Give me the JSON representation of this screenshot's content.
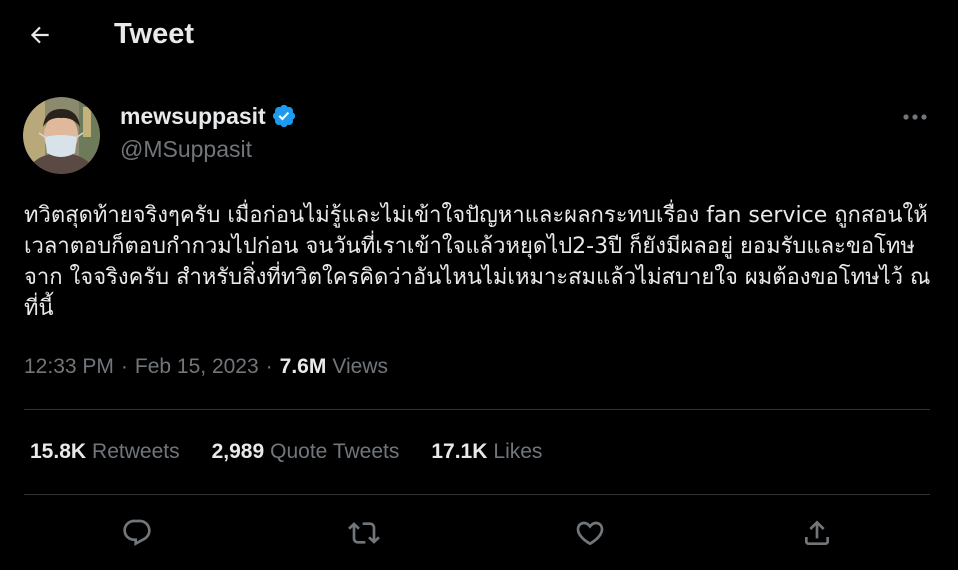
{
  "header": {
    "title": "Tweet",
    "back_icon": "arrow-left-icon"
  },
  "author": {
    "name": "mewsuppasit",
    "handle": "@MSuppasit",
    "verified": true,
    "verified_color": "#1d9bf0"
  },
  "tweet": {
    "text": "ทวิตสุดท้ายจริงๆครับ เมื่อก่อนไม่รู้และไม่เข้าใจปัญหาและผลกระทบเรื่อง fan service ถูกสอนให้เวลาตอบก็ตอบกำกวมไปก่อน จนวันที่เราเข้าใจแล้วหยุดไป2-3ปี ก็ยังมีผลอยู่ ยอมรับและขอโทษจาก ใจจริงครับ สำหรับสิ่งที่ทวิตใครคิดว่าอันไหนไม่เหมาะสมแล้วไม่สบายใจ ผมต้องขอโทษไว้ ณ ที่นี้",
    "time": "12:33 PM",
    "separator": "·",
    "date": "Feb 15, 2023",
    "views_count": "7.6M",
    "views_label": "Views"
  },
  "stats": {
    "retweets_count": "15.8K",
    "retweets_label": "Retweets",
    "quotes_count": "2,989",
    "quotes_label": "Quote Tweets",
    "likes_count": "17.1K",
    "likes_label": "Likes"
  },
  "actions": {
    "icons": [
      "reply-icon",
      "retweet-icon",
      "like-icon",
      "share-icon"
    ]
  },
  "colors": {
    "background": "#000000",
    "text_primary": "#e7e9ea",
    "text_secondary": "#71767b",
    "divider": "#2f3336",
    "accent": "#1d9bf0"
  }
}
